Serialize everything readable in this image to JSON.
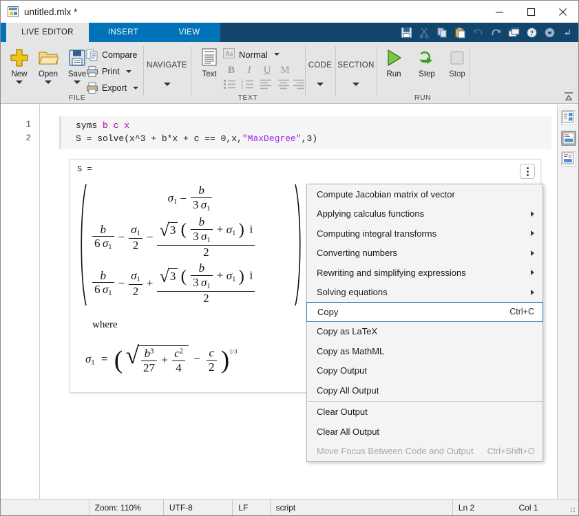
{
  "window": {
    "title": "untitled.mlx *",
    "icon": "matlab-live-script-icon",
    "minimize_label": "Minimize",
    "maximize_label": "Maximize",
    "close_label": "Close"
  },
  "quick_access": {
    "items": [
      {
        "name": "save-icon",
        "label": "Save"
      },
      {
        "name": "cut-icon",
        "label": "Cut",
        "disabled": true
      },
      {
        "name": "copy-icon",
        "label": "Copy",
        "disabled": true
      },
      {
        "name": "paste-icon",
        "label": "Paste"
      },
      {
        "name": "undo-icon",
        "label": "Undo"
      },
      {
        "name": "redo-icon",
        "label": "Redo",
        "disabled": true
      },
      {
        "name": "window-layout-icon",
        "label": "Layout"
      },
      {
        "name": "help-icon",
        "label": "Help"
      },
      {
        "name": "customize-icon",
        "label": "Customize"
      }
    ]
  },
  "ribbon": {
    "tabs": [
      {
        "label": "LIVE EDITOR",
        "active": true
      },
      {
        "label": "INSERT",
        "active": false
      },
      {
        "label": "VIEW",
        "active": false
      }
    ],
    "groups": [
      {
        "name": "file",
        "label": "FILE",
        "big_buttons": [
          {
            "label": "New",
            "icon": "new-file-icon",
            "has_dropdown": true
          },
          {
            "label": "Open",
            "icon": "open-folder-icon",
            "has_dropdown": true
          },
          {
            "label": "Save",
            "icon": "save-disk-icon",
            "has_dropdown": true
          }
        ],
        "small_buttons": [
          {
            "label": "Compare",
            "icon": "compare-icon",
            "has_dropdown": false
          },
          {
            "label": "Print",
            "icon": "print-icon",
            "has_dropdown": true
          },
          {
            "label": "Export",
            "icon": "export-icon",
            "has_dropdown": true
          }
        ]
      },
      {
        "name": "navigate",
        "label": "NAVIGATE",
        "title_only": true
      },
      {
        "name": "text",
        "label": "TEXT",
        "big_buttons": [
          {
            "label": "Text",
            "icon": "text-block-icon",
            "has_dropdown": false
          }
        ],
        "style_label": "Normal",
        "style_icon": "style-aa-icon",
        "format_buttons": [
          {
            "label": "B",
            "name": "bold-button"
          },
          {
            "label": "I",
            "name": "italic-button"
          },
          {
            "label": "U",
            "name": "underline-button"
          },
          {
            "label": "M",
            "name": "monospace-button"
          }
        ],
        "list_buttons": [
          {
            "name": "bulleted-list-button"
          },
          {
            "name": "numbered-list-button"
          },
          {
            "name": "align-left-button"
          },
          {
            "name": "align-center-button"
          },
          {
            "name": "align-right-button"
          }
        ]
      },
      {
        "name": "code",
        "label": "CODE",
        "title_only": true
      },
      {
        "name": "section",
        "label": "SECTION",
        "title_only": true
      },
      {
        "name": "run",
        "label": "RUN",
        "big_buttons": [
          {
            "label": "Run",
            "icon": "run-play-icon",
            "has_dropdown": false
          },
          {
            "label": "Step",
            "icon": "step-icon",
            "has_dropdown": false
          },
          {
            "label": "Stop",
            "icon": "stop-icon",
            "has_dropdown": false
          }
        ]
      }
    ],
    "collapse_icon": "collapse-ribbon-icon"
  },
  "editor": {
    "line_numbers": [
      "1",
      "2"
    ],
    "code_lines": [
      [
        {
          "t": "syms ",
          "c": "plain"
        },
        {
          "t": "b",
          "c": "var"
        },
        {
          "t": " ",
          "c": "plain"
        },
        {
          "t": "c",
          "c": "var"
        },
        {
          "t": " ",
          "c": "plain"
        },
        {
          "t": "x",
          "c": "var"
        }
      ],
      [
        {
          "t": "S = solve(x^3 + b*x + c == 0,x,",
          "c": "plain"
        },
        {
          "t": "\"MaxDegree\"",
          "c": "str"
        },
        {
          "t": ",3)",
          "c": "plain"
        }
      ]
    ],
    "output": {
      "variable_label": "S =",
      "menu_button": "output-options-icon",
      "where_label": "where",
      "matrix": {
        "rows": [
          "sigma_1 - b/(3*sigma_1)",
          "b/(6*sigma_1) - sigma_1/2 - (sqrt(3)*(b/(3*sigma_1) + sigma_1)*i)/2",
          "b/(6*sigma_1) - sigma_1/2 + (sqrt(3)*(b/(3*sigma_1) + sigma_1)*i)/2"
        ]
      },
      "sigma_definition": "sigma_1 = (sqrt(b^3/27 + c^2/4) - c/2)^(1/3)",
      "symbols": {
        "sigma": "σ",
        "sigma_index": "1",
        "b": "b",
        "c": "c",
        "i": "i",
        "three": "3",
        "two": "2",
        "six": "6",
        "twentyseven": "27",
        "four": "4",
        "exp_b": "3",
        "exp_c": "2",
        "power": "1/3",
        "radical": "√"
      }
    }
  },
  "right_dock": {
    "buttons": [
      {
        "name": "dock-layout-outline-icon",
        "selected": false
      },
      {
        "name": "dock-layout-output-inline-icon",
        "selected": true
      },
      {
        "name": "dock-layout-output-right-icon",
        "selected": false
      }
    ]
  },
  "context_menu": {
    "items": [
      {
        "label": "Compute Jacobian matrix of vector",
        "submenu": false,
        "accel": "",
        "disabled": false,
        "selected": false,
        "separator_before": false
      },
      {
        "label": "Applying calculus functions",
        "submenu": true,
        "accel": "",
        "disabled": false,
        "selected": false,
        "separator_before": false
      },
      {
        "label": "Computing integral transforms",
        "submenu": true,
        "accel": "",
        "disabled": false,
        "selected": false,
        "separator_before": false
      },
      {
        "label": "Converting numbers",
        "submenu": true,
        "accel": "",
        "disabled": false,
        "selected": false,
        "separator_before": false
      },
      {
        "label": "Rewriting and simplifying expressions",
        "submenu": true,
        "accel": "",
        "disabled": false,
        "selected": false,
        "separator_before": false
      },
      {
        "label": "Solving equations",
        "submenu": true,
        "accel": "",
        "disabled": false,
        "selected": false,
        "separator_before": false
      },
      {
        "label": "Copy",
        "submenu": false,
        "accel": "Ctrl+C",
        "disabled": false,
        "selected": true,
        "separator_before": false
      },
      {
        "label": "Copy as LaTeX",
        "submenu": false,
        "accel": "",
        "disabled": false,
        "selected": false,
        "separator_before": false
      },
      {
        "label": "Copy as MathML",
        "submenu": false,
        "accel": "",
        "disabled": false,
        "selected": false,
        "separator_before": false
      },
      {
        "label": "Copy Output",
        "submenu": false,
        "accel": "",
        "disabled": false,
        "selected": false,
        "separator_before": false
      },
      {
        "label": "Copy All Output",
        "submenu": false,
        "accel": "",
        "disabled": false,
        "selected": false,
        "separator_before": false
      },
      {
        "label": "Clear Output",
        "submenu": false,
        "accel": "",
        "disabled": false,
        "selected": false,
        "separator_before": true
      },
      {
        "label": "Clear All Output",
        "submenu": false,
        "accel": "",
        "disabled": false,
        "selected": false,
        "separator_before": false
      },
      {
        "label": "Move Focus Between Code and Output",
        "submenu": false,
        "accel": "Ctrl+Shift+O",
        "disabled": true,
        "selected": false,
        "separator_before": false
      }
    ]
  },
  "status_bar": {
    "zoom": "Zoom: 110%",
    "encoding": "UTF-8",
    "line_ending": "LF",
    "file_type": "script",
    "line": "Ln  2",
    "column": "Col  1"
  },
  "colors": {
    "ribbon_accent": "#0072b8",
    "ribbon_accent_dark": "#12456b",
    "ribbon_bg": "#e5e5e5",
    "selection_border": "#2c7fb8",
    "string_literal": "#a020f0",
    "variable": "#aa00aa"
  }
}
